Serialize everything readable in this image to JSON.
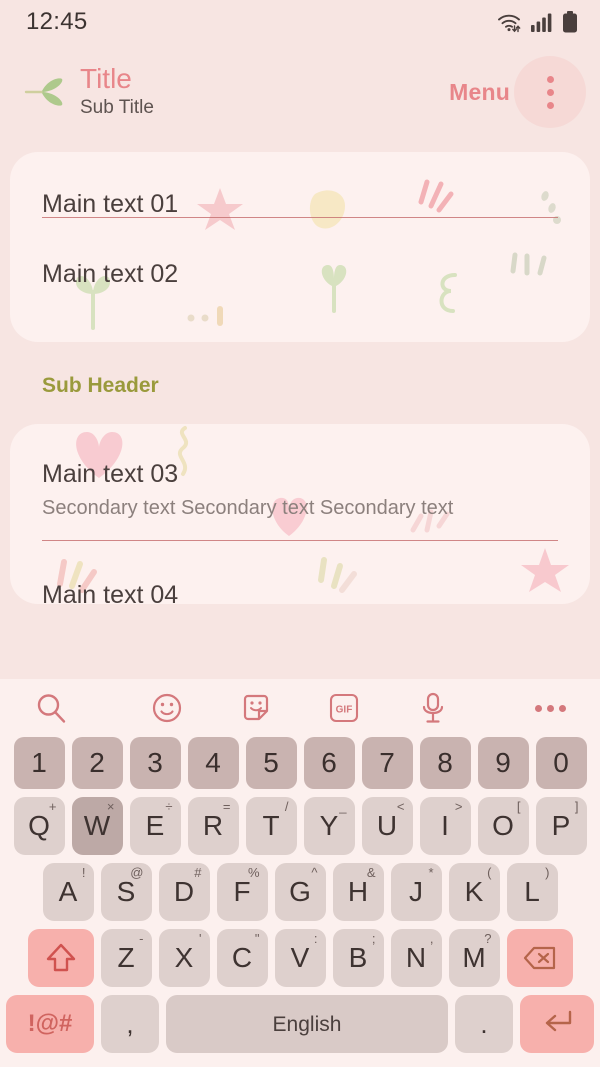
{
  "status_bar": {
    "time": "12:45",
    "icons": [
      "wifi-icon",
      "cellular-signal-icon",
      "battery-icon"
    ]
  },
  "header": {
    "back_icon": "back-leaf-icon",
    "title": "Title",
    "subtitle": "Sub Title",
    "menu_label": "Menu",
    "menu_icon": "more-vertical-icon"
  },
  "content": {
    "card1": {
      "rows": [
        {
          "main": "Main text 01"
        },
        {
          "main": "Main text 02"
        }
      ]
    },
    "sub_header": "Sub Header",
    "card2": {
      "rows": [
        {
          "main": "Main text 03",
          "secondary": "Secondary text Secondary text Secondary text"
        },
        {
          "main": "Main text 04"
        }
      ]
    }
  },
  "keyboard": {
    "toolbar": [
      {
        "name": "search-icon",
        "label": "search"
      },
      {
        "name": "emoji-icon",
        "label": "emoji"
      },
      {
        "name": "sticker-icon",
        "label": "sticker"
      },
      {
        "name": "gif-icon",
        "label": "GIF"
      },
      {
        "name": "microphone-icon",
        "label": "voice input"
      },
      {
        "name": "more-horizontal-icon",
        "label": "more"
      }
    ],
    "rows": {
      "numbers": [
        {
          "key": "1"
        },
        {
          "key": "2"
        },
        {
          "key": "3"
        },
        {
          "key": "4"
        },
        {
          "key": "5"
        },
        {
          "key": "6"
        },
        {
          "key": "7"
        },
        {
          "key": "8"
        },
        {
          "key": "9"
        },
        {
          "key": "0"
        }
      ],
      "top": [
        {
          "key": "Q",
          "sup": "+"
        },
        {
          "key": "W",
          "sup": "×",
          "highlighted": true
        },
        {
          "key": "E",
          "sup": "÷"
        },
        {
          "key": "R",
          "sup": "="
        },
        {
          "key": "T",
          "sup": "/"
        },
        {
          "key": "Y",
          "sup": "_"
        },
        {
          "key": "U",
          "sup": "<"
        },
        {
          "key": "I",
          "sup": ">"
        },
        {
          "key": "O",
          "sup": "["
        },
        {
          "key": "P",
          "sup": "]"
        }
      ],
      "home": [
        {
          "key": "A",
          "sup": "!"
        },
        {
          "key": "S",
          "sup": "@"
        },
        {
          "key": "D",
          "sup": "#"
        },
        {
          "key": "F",
          "sup": "%"
        },
        {
          "key": "G",
          "sup": "^"
        },
        {
          "key": "H",
          "sup": "&"
        },
        {
          "key": "J",
          "sup": "*"
        },
        {
          "key": "K",
          "sup": "("
        },
        {
          "key": "L",
          "sup": ")"
        }
      ],
      "bottom_letters": [
        {
          "key": "Z",
          "sup": "-"
        },
        {
          "key": "X",
          "sup": "'"
        },
        {
          "key": "C",
          "sup": "\""
        },
        {
          "key": "V",
          "sup": ":"
        },
        {
          "key": "B",
          "sup": ";"
        },
        {
          "key": "N",
          "sup": ","
        },
        {
          "key": "M",
          "sup": "?"
        }
      ],
      "shift_key": "shift-icon",
      "backspace_key": "backspace-icon",
      "symbols_key": "!@#",
      "comma_key": ",",
      "space_key": "English",
      "period_key": ".",
      "enter_key": "enter-icon"
    }
  },
  "colors": {
    "page_background": "#f7e5e2",
    "card_background": "#fdf1ef",
    "accent_pink": "#e8868a",
    "sub_header_olive": "#9a9a3c",
    "divider": "#c46b6b",
    "key_number": "#c9b3b0",
    "key_letter": "#ded0cd",
    "key_function": "#f7b0ac",
    "keyboard_background": "#fcf0ee"
  }
}
